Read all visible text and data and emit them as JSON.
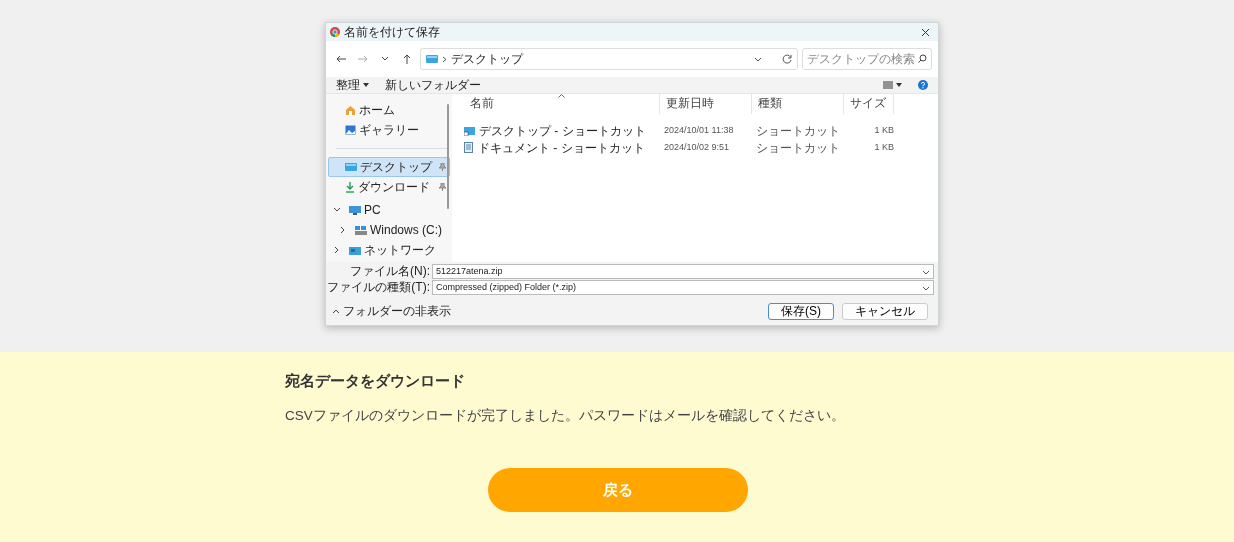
{
  "dialog": {
    "title": "名前を付けて保存",
    "nav_buttons": [
      {
        "kind": "back",
        "disabled": false
      },
      {
        "kind": "forward",
        "disabled": true
      },
      {
        "kind": "recent",
        "disabled": false
      },
      {
        "kind": "up",
        "disabled": false
      }
    ],
    "address": "デスクトップ",
    "search": {
      "placeholder": "デスクトップの検索"
    },
    "toolbar": {
      "organize": "整理",
      "new_folder": "新しいフォルダー"
    },
    "sidebar": {
      "quick": [
        {
          "label": "ホーム",
          "kind": "home"
        },
        {
          "label": "ギャラリー",
          "kind": "gallery"
        }
      ],
      "pinned": [
        {
          "label": "デスクトップ",
          "kind": "desktop",
          "selected": true
        },
        {
          "label": "ダウンロード",
          "kind": "download",
          "selected": false
        }
      ],
      "tree": [
        {
          "label": "PC",
          "kind": "pc",
          "expanded": true,
          "children": [
            {
              "label": "Windows (C:)",
              "kind": "drive",
              "expanded": false
            }
          ]
        },
        {
          "label": "ネットワーク",
          "kind": "network",
          "expanded": false
        }
      ]
    },
    "columns": [
      {
        "label": "名前",
        "sorted": true
      },
      {
        "label": "更新日時",
        "sorted": false
      },
      {
        "label": "種類",
        "sorted": false
      },
      {
        "label": "サイズ",
        "sorted": false
      }
    ],
    "rows": [
      {
        "name": "デスクトップ - ショートカット",
        "kind": "desktop",
        "date": "2024/10/01 11:38",
        "type": "ショートカット",
        "size": "1 KB"
      },
      {
        "name": "ドキュメント - ショートカット",
        "kind": "document",
        "date": "2024/10/02 9:51",
        "type": "ショートカット",
        "size": "1 KB"
      }
    ],
    "file_name": {
      "label": "ファイル名(N):",
      "value": "512217atena.zip"
    },
    "file_type": {
      "label": "ファイルの種類(T):",
      "value": "Compressed (zipped) Folder (*.zip)"
    },
    "hide_folders": "フォルダーの非表示",
    "buttons": [
      {
        "label": "保存(S)",
        "default": true
      },
      {
        "label": "キャンセル",
        "default": false
      }
    ]
  },
  "panel": {
    "heading": "宛名データをダウンロード",
    "message": "CSVファイルのダウンロードが完了しました。パスワードはメールを確認してください。",
    "back_button": "戻る"
  }
}
